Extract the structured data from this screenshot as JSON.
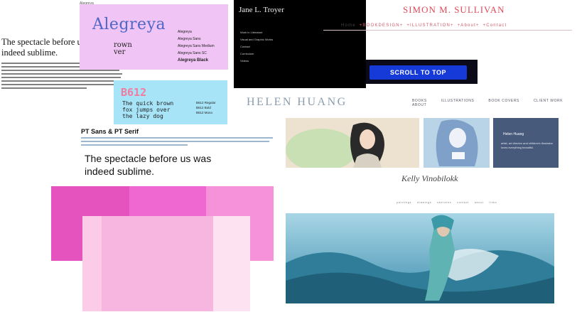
{
  "typography": {
    "spectacle_line": "The spectacle before us was indeed sublime."
  },
  "alegreya": {
    "small_label": "Alegreya",
    "title": "Alegreya",
    "fragment_1": "rown",
    "fragment_2": "ver",
    "variants": [
      "Alegreya",
      "Alegreya Sans",
      "Alegreya Sans Medium",
      "Alegreya Sans SC",
      "Alegreya Black"
    ]
  },
  "b612": {
    "title": "B612",
    "pangram_1": "The quick brown",
    "pangram_2": "fox jumps over",
    "pangram_3": "the lazy dog",
    "variants": [
      "B612 Regular",
      "B612 Bold",
      "B612 Mono"
    ]
  },
  "pt": {
    "title": "PT Sans & PT Serif",
    "spectacle_line": "The spectacle before us was indeed sublime."
  },
  "jane": {
    "title": "Jane L. Troyer",
    "nav": [
      "Work in Literature",
      "Visual and Graphic Works",
      "Contact",
      "Curriculum",
      "Videos"
    ]
  },
  "simon": {
    "title": "SIMON M. SULLIVAN",
    "nav": [
      "Home",
      "+BOOKDESIGN+",
      "+ILLUSTRATION+",
      "+About+",
      "+Contact"
    ]
  },
  "scroll": {
    "label": "SCROLL TO TOP"
  },
  "helen": {
    "title": "HELEN HUANG",
    "nav": [
      "BOOKS",
      "ILLUSTRATIONS",
      "BOOK COVERS",
      "CLIENT WORK",
      "ABOUT"
    ],
    "card_title": "Helen Huang",
    "card_text": "artist, art director and children's illustrator loves everything beautiful.",
    "signature": "Kelly Vinobilokk",
    "signature_nav": [
      "paintings",
      "drawings",
      "sketches",
      "contact",
      "about",
      "links"
    ]
  },
  "colors": {
    "pink_dark": "#e553be",
    "pink_mid": "#ef68d1",
    "pink_light": "#f592d9",
    "alegreya_bg": "#f0c4f4",
    "b612_bg": "#a7e4f8",
    "scroll_blue": "#163ad8"
  }
}
